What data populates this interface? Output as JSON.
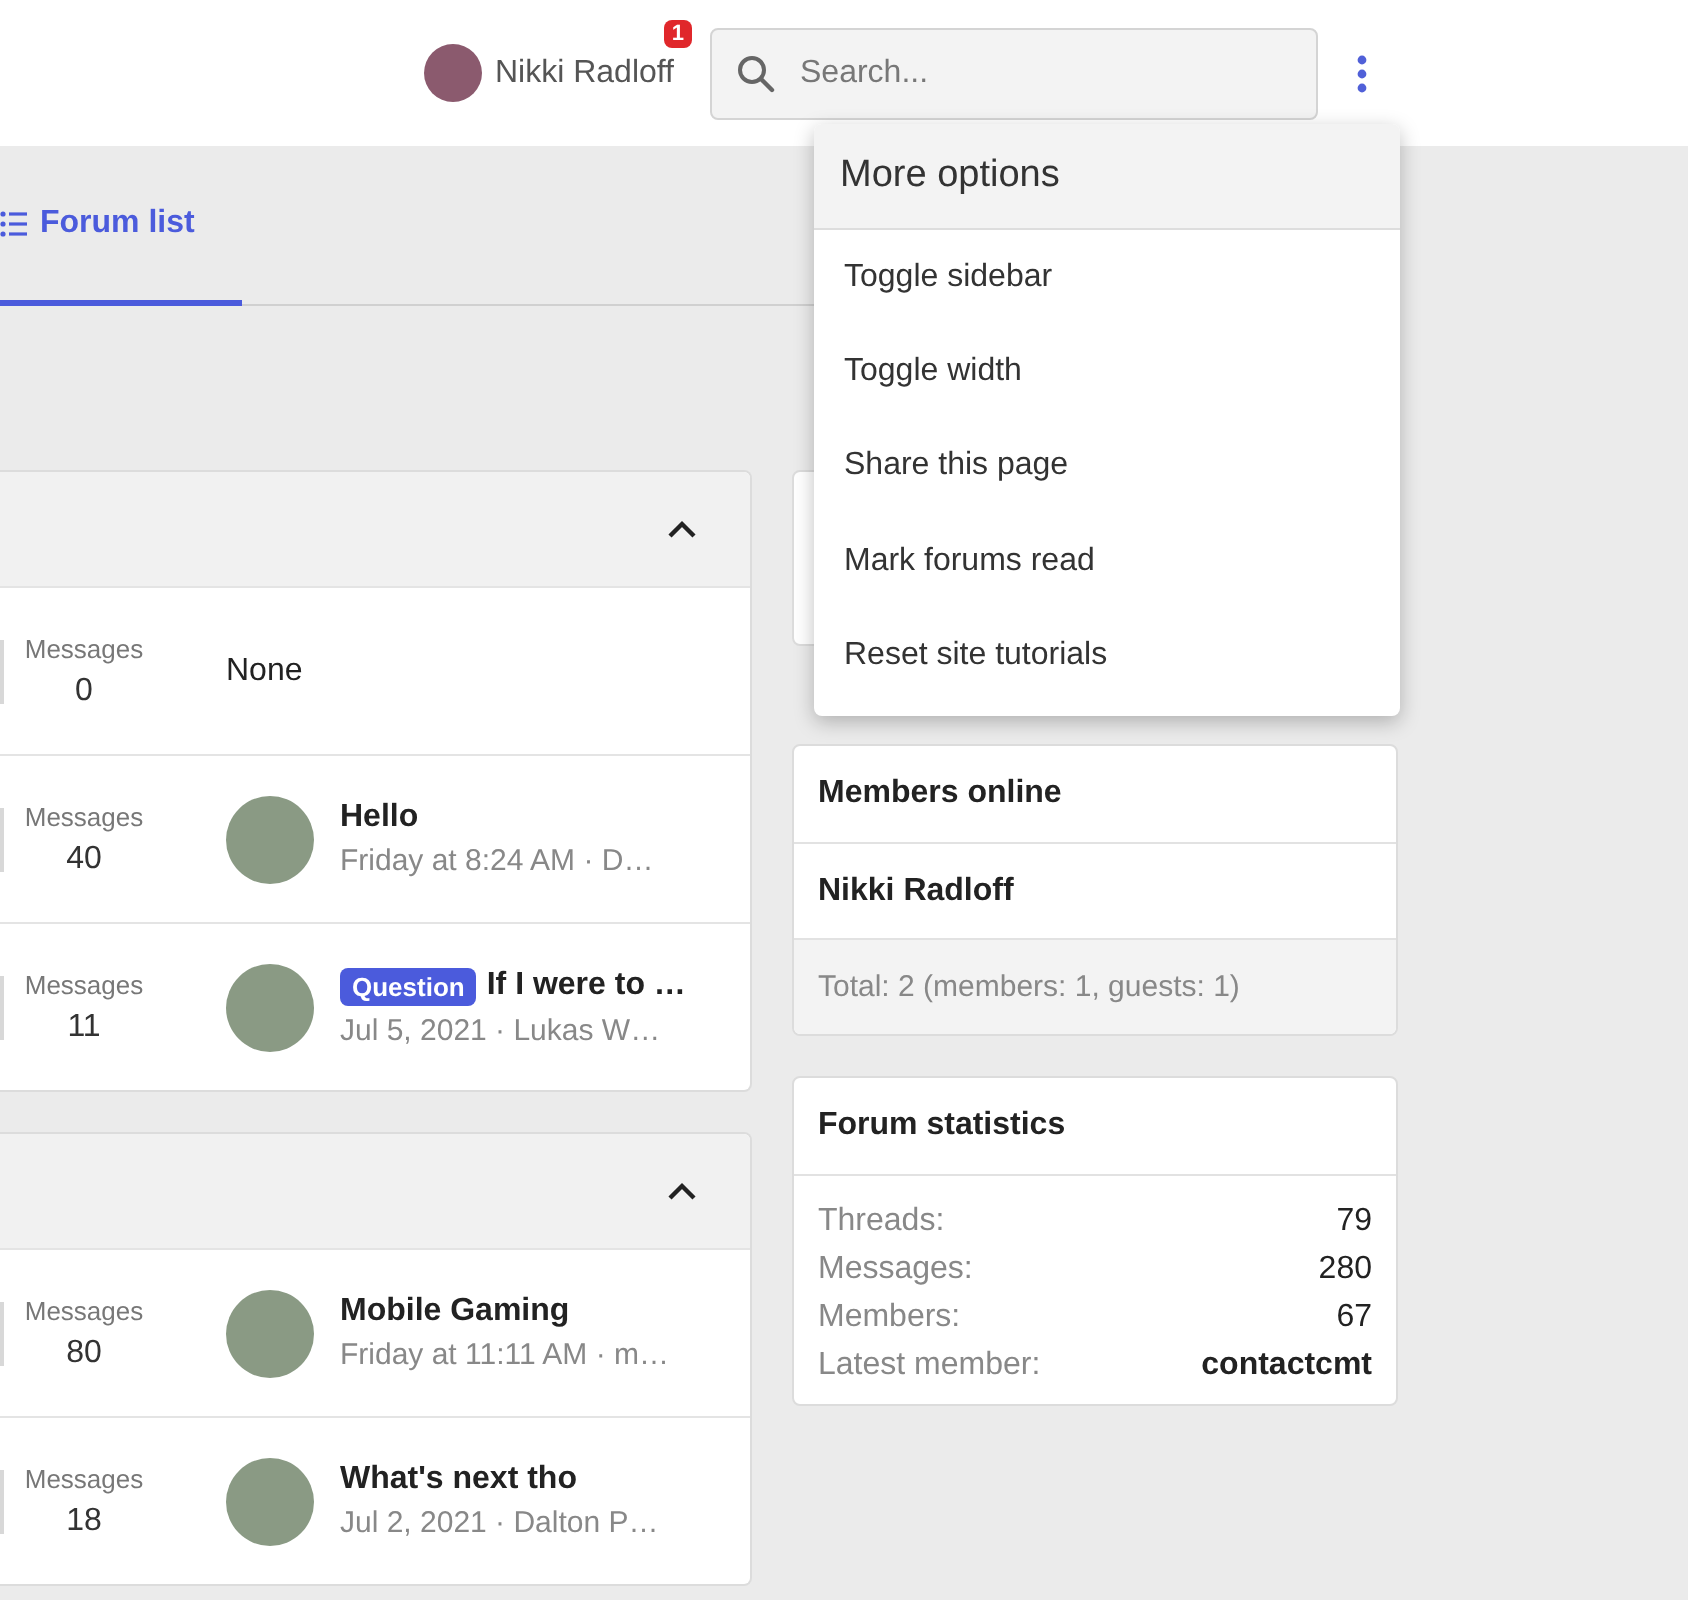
{
  "header": {
    "user": {
      "name": "Nikki Radloff",
      "alert_count": "1"
    },
    "search": {
      "placeholder": "Search..."
    }
  },
  "menu": {
    "title": "More options",
    "items": [
      "Toggle sidebar",
      "Toggle width",
      "Share this page",
      "Mark forums read",
      "Reset site tutorials"
    ]
  },
  "tabs": [
    {
      "label": "Forum list",
      "selected": true
    }
  ],
  "categories": [
    {
      "expanded": true,
      "forums": [
        {
          "messages_label": "Messages",
          "messages": "0",
          "latest": {
            "kind": "none",
            "text": "None"
          }
        },
        {
          "messages_label": "Messages",
          "messages": "40",
          "latest": {
            "kind": "thread",
            "title": "Hello",
            "meta": "Friday at 8:24 AM · D…"
          }
        },
        {
          "messages_label": "Messages",
          "messages": "11",
          "latest": {
            "kind": "thread",
            "prefix": "Question",
            "title": "If I were to …",
            "meta": "Jul 5, 2021 · Lukas W…"
          }
        }
      ]
    },
    {
      "expanded": true,
      "forums": [
        {
          "messages_label": "Messages",
          "messages": "80",
          "latest": {
            "kind": "thread",
            "title": "Mobile Gaming",
            "meta": "Friday at 11:11 AM · m…"
          }
        },
        {
          "messages_label": "Messages",
          "messages": "18",
          "latest": {
            "kind": "thread",
            "title": "What's next tho",
            "meta": "Jul 2, 2021 · Dalton P…"
          }
        }
      ]
    }
  ],
  "sidebar": {
    "members_online": {
      "title": "Members online",
      "members": [
        "Nikki Radloff"
      ],
      "footer": "Total: 2 (members: 1, guests: 1)"
    },
    "forum_statistics": {
      "title": "Forum statistics",
      "rows": [
        {
          "label": "Threads:",
          "value": "79"
        },
        {
          "label": "Messages:",
          "value": "280"
        },
        {
          "label": "Members:",
          "value": "67"
        },
        {
          "label": "Latest member:",
          "value": "contactcmt"
        }
      ]
    }
  }
}
